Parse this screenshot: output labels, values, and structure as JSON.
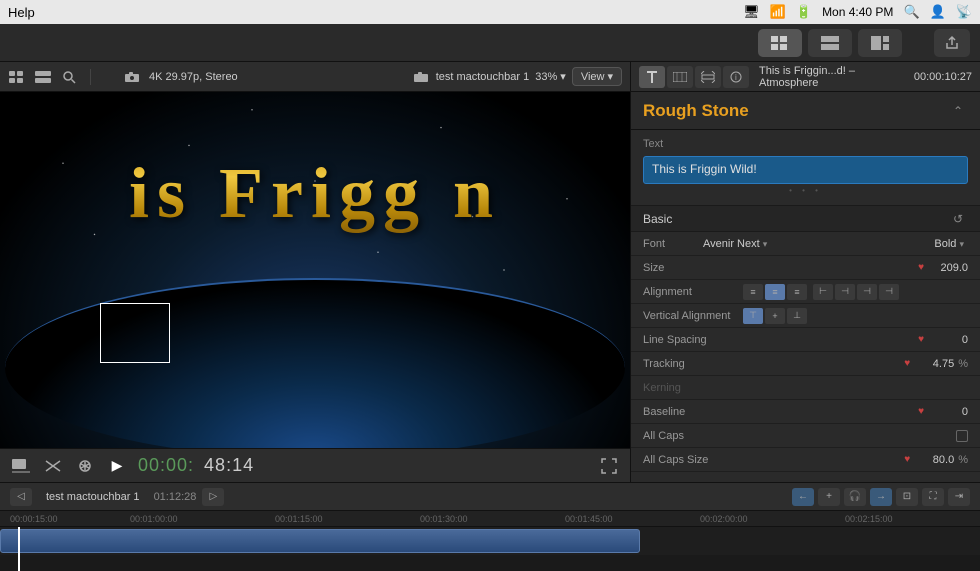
{
  "menubar": {
    "items": [
      "Help"
    ],
    "time": "Mon 4:40 PM"
  },
  "toolbar": {
    "resolution": "4K 29.97p, Stereo",
    "clip_name": "test mactouchbar 1",
    "zoom": "33%",
    "view_label": "View"
  },
  "playback": {
    "current_time": "48:14",
    "time_prefix": "00:00:"
  },
  "inspector": {
    "title": "This is Friggin...d! – Atmosphere",
    "duration": "10:27",
    "timecode": "00:00:",
    "tabs": [
      "T",
      "☰",
      "☰☰",
      "ℹ"
    ]
  },
  "effect": {
    "name": "Rough Stone"
  },
  "text_section": {
    "label": "Text",
    "value": "This is Friggin Wild!"
  },
  "basic_section": {
    "label": "Basic",
    "font_label": "Font",
    "font_name": "Avenir Next",
    "font_style": "Bold",
    "size_label": "Size",
    "size_value": "209.0",
    "alignment_label": "Alignment",
    "vertical_alignment_label": "Vertical Alignment",
    "line_spacing_label": "Line Spacing",
    "line_spacing_value": "0",
    "tracking_label": "Tracking",
    "tracking_value": "4.75",
    "tracking_unit": "%",
    "kerning_label": "Kerning",
    "baseline_label": "Baseline",
    "baseline_value": "0",
    "all_caps_label": "All Caps",
    "all_caps_size_label": "All Caps Size",
    "all_caps_size_value": "80.0",
    "all_caps_size_unit": "%"
  },
  "timeline": {
    "clip_name": "test mactouchbar 1",
    "clip_time": "01:12:28",
    "timecodes": [
      "00:00:15:00",
      "00:01:00:00",
      "00:01:15:00",
      "00:01:30:00",
      "00:01:45:00",
      "00:02:00:00",
      "00:02:15:00"
    ]
  },
  "icons": {
    "grid": "⊞",
    "filmstrip": "▦",
    "search": "⌕",
    "camera": "⬛",
    "chevron_down": "▾",
    "play": "▶",
    "skip_back": "⏮",
    "skip_fwd": "⏭",
    "fullscreen": "⛶",
    "collapse": "⌄",
    "heart": "♥",
    "undo": "↺",
    "zoom_in": "⊕",
    "link": "⛓"
  }
}
